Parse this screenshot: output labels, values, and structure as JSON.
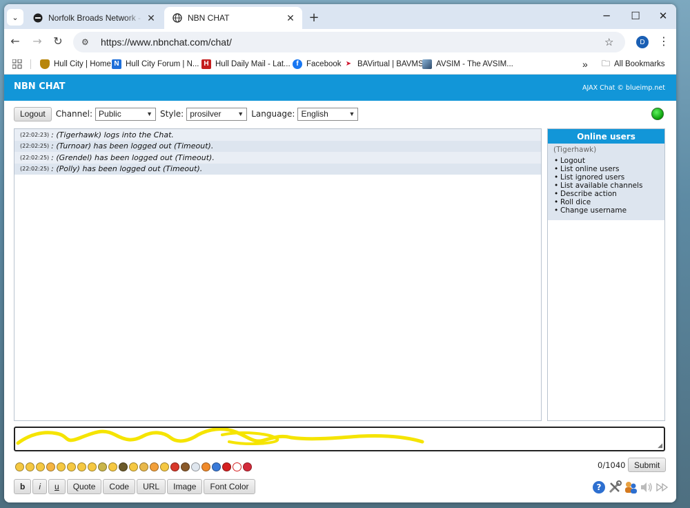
{
  "browser": {
    "tabs": [
      {
        "title": "Norfolk Broads Network - Forum",
        "active": false
      },
      {
        "title": "NBN CHAT",
        "active": true
      }
    ],
    "url": "https://www.nbnchat.com/chat/",
    "profile_initial": "D",
    "bookmarks": [
      {
        "label": "Hull City | Home",
        "icon": "hull-city-crest-icon",
        "color": "#b8860b"
      },
      {
        "label": "Hull City Forum | N...",
        "icon": "forum-n-icon",
        "color": "#1e6fd9"
      },
      {
        "label": "Hull Daily Mail - Lat...",
        "icon": "hull-daily-mail-icon",
        "color": "#c41e1e"
      },
      {
        "label": "Facebook",
        "icon": "facebook-icon",
        "color": "#1877f2"
      },
      {
        "label": "BAVirtual | BAVMS",
        "icon": "bavirtual-icon",
        "color": "#d0142c"
      },
      {
        "label": "AVSIM - The AVSIM...",
        "icon": "avsim-icon",
        "color": "#2d4a6a"
      }
    ],
    "more_bookmarks": "»",
    "all_bookmarks": "All Bookmarks"
  },
  "chat": {
    "title": "NBN CHAT",
    "credit": "AJAX Chat © blueimp.net",
    "logout_label": "Logout",
    "channel_label": "Channel:",
    "channel_value": "Public",
    "style_label": "Style:",
    "style_value": "prosilver",
    "language_label": "Language:",
    "language_value": "English",
    "status_color": "#11b511",
    "messages": [
      {
        "time": "(22:02:23)",
        "text": ": (Tigerhawk) logs into the Chat."
      },
      {
        "time": "(22:02:25)",
        "text": ": (Turnoar) has been logged out (Timeout)."
      },
      {
        "time": "(22:02:25)",
        "text": ": (Grendel) has been logged out (Timeout)."
      },
      {
        "time": "(22:02:25)",
        "text": ": (Polly) has been logged out (Timeout)."
      }
    ],
    "online_header": "Online users",
    "online_user": "(Tigerhawk)",
    "user_menu": [
      "Logout",
      "List online users",
      "List ignored users",
      "List available channels",
      "Describe action",
      "Roll dice",
      "Change username"
    ],
    "char_counter": "0/1040",
    "submit_label": "Submit",
    "format_buttons": [
      "b",
      "i",
      "u",
      "Quote",
      "Code",
      "URL",
      "Image",
      "Font Color"
    ],
    "accent_color": "#1296d8"
  }
}
